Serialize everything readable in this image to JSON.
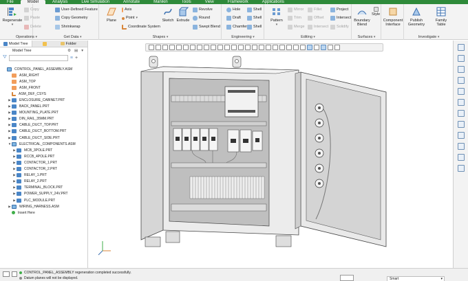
{
  "tabs": [
    "File",
    "Model",
    "Analysis",
    "Live Simulation",
    "Annotate",
    "Manikin",
    "Tools",
    "View",
    "Framework",
    "Applications"
  ],
  "active_tab": 1,
  "ribbon": {
    "operations": {
      "title": "Operations",
      "regenerate": "Regenerate",
      "copy": "Copy",
      "paste": "Paste",
      "delete": "Delete"
    },
    "get_data": {
      "title": "Get Data",
      "udf": "User-Defined Feature",
      "copy_geometry": "Copy Geometry",
      "shrinkwrap": "Shrinkwrap"
    },
    "shapes": {
      "title": "Shapes",
      "plane": "Plane",
      "axis": "Axis",
      "point": "Point",
      "csys": "Coordinate System",
      "sketch": "Sketch",
      "extrude": "Extrude",
      "revolve": "Revolve",
      "round": "Round",
      "swept_blend": "Swept Blend"
    },
    "engineering": {
      "title": "Engineering",
      "hole": "Hole",
      "draft": "Draft",
      "chamfer": "Chamfer",
      "shell": "Shell",
      "shell2": "Shell"
    },
    "editing": {
      "title": "Editing",
      "pattern": "Pattern",
      "mirror": "Mirror",
      "trim": "Trim",
      "merge": "Merge",
      "fillet": "Fillet",
      "offset": "Offset",
      "intersect": "Intersect",
      "project": "Project",
      "intersect2": "Intersect",
      "solidify": "Solidify"
    },
    "surfaces": {
      "title": "Surfaces",
      "boundary_blend": "Boundary Blend",
      "style": "Style"
    },
    "component": {
      "label": "Component Interface"
    },
    "investigate": {
      "title": "Investigate",
      "publish": "Publish Geometry",
      "family": "Family Table"
    }
  },
  "left_panel": {
    "tabs": [
      "Model Tree",
      "",
      "Folder"
    ],
    "tree_header": "Model Tree",
    "filter_placeholder": "",
    "nodes": [
      {
        "label": "CONTROL_PANEL_ASSEMBLY.ASM",
        "kind": "asm",
        "level": 0,
        "exp": ""
      },
      {
        "label": "ASM_RIGHT",
        "kind": "datum",
        "level": 1,
        "exp": ""
      },
      {
        "label": "ASM_TOP",
        "kind": "datum",
        "level": 1,
        "exp": ""
      },
      {
        "label": "ASM_FRONT",
        "kind": "datum",
        "level": 1,
        "exp": ""
      },
      {
        "label": "ASM_DEF_CSYS",
        "kind": "csys",
        "level": 1,
        "exp": ""
      },
      {
        "label": "ENCLOSURE_CABINET.PRT",
        "kind": "prt",
        "level": 1,
        "exp": "▶"
      },
      {
        "label": "BACK_PANEL.PRT",
        "kind": "prt",
        "level": 1,
        "exp": "▶"
      },
      {
        "label": "MOUNTING_PLATE.PRT",
        "kind": "prt",
        "level": 1,
        "exp": "▶"
      },
      {
        "label": "DIN_RAIL_35MM.PRT",
        "kind": "prt",
        "level": 1,
        "exp": "▶"
      },
      {
        "label": "CABLE_DUCT_TOP.PRT",
        "kind": "prt",
        "level": 1,
        "exp": "▶"
      },
      {
        "label": "CABLE_DUCT_BOTTOM.PRT",
        "kind": "prt",
        "level": 1,
        "exp": "▶"
      },
      {
        "label": "CABLE_DUCT_SIDE.PRT",
        "kind": "prt",
        "level": 1,
        "exp": "▶"
      },
      {
        "label": "ELECTRICAL_COMPONENTS.ASM",
        "kind": "asm",
        "level": 1,
        "exp": "▼"
      },
      {
        "label": "MCB_3POLE.PRT",
        "kind": "prt",
        "level": 2,
        "exp": "▶"
      },
      {
        "label": "RCCB_4POLE.PRT",
        "kind": "prt",
        "level": 2,
        "exp": "▶"
      },
      {
        "label": "CONTACTOR_1.PRT",
        "kind": "prt",
        "level": 2,
        "exp": "▶"
      },
      {
        "label": "CONTACTOR_2.PRT",
        "kind": "prt",
        "level": 2,
        "exp": "▶"
      },
      {
        "label": "RELAY_1.PRT",
        "kind": "prt",
        "level": 2,
        "exp": "▶"
      },
      {
        "label": "RELAY_2.PRT",
        "kind": "prt",
        "level": 2,
        "exp": "▶"
      },
      {
        "label": "TERMINAL_BLOCK.PRT",
        "kind": "prt",
        "level": 2,
        "exp": "▶"
      },
      {
        "label": "POWER_SUPPLY_24V.PRT",
        "kind": "prt",
        "level": 2,
        "exp": "▶"
      },
      {
        "label": "PLC_MODULE.PRT",
        "kind": "prt",
        "level": 2,
        "exp": "▶"
      },
      {
        "label": "WIRING_HARNESS.ASM",
        "kind": "asm",
        "level": 1,
        "exp": "▶"
      },
      {
        "label": "Insert Here",
        "kind": "insert",
        "level": 1,
        "exp": ""
      }
    ]
  },
  "status": {
    "line1": "CONTROL_PANEL_ASSEMBLY regeneration completed successfully.",
    "line2": "Datum planes will not be displayed.",
    "filter_value": "Smart"
  },
  "colors": {
    "accent": "#2e8a3a",
    "ribbon_bg": "#f3f3f3",
    "part_blue": "#4a86c7",
    "datum_orange": "#f29d5b"
  }
}
